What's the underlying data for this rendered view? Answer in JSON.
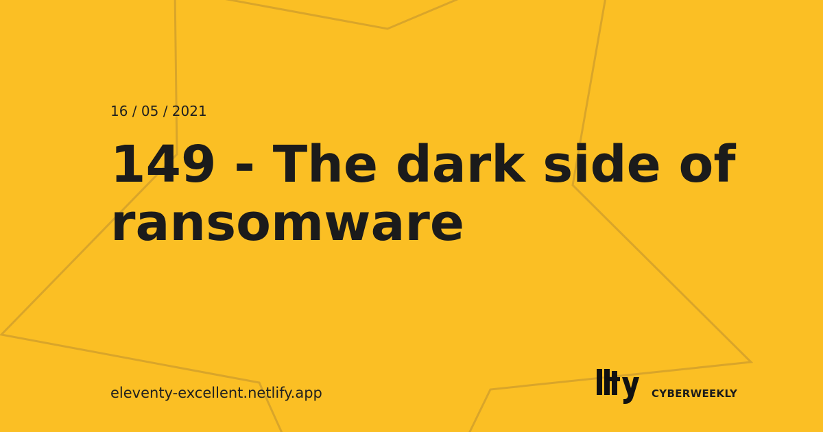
{
  "post": {
    "date": "16 / 05 / 2021",
    "title": "149 - The dark side of ransomware"
  },
  "footer": {
    "site_url": "eleventy-excellent.netlify.app",
    "logo_icon": "11ty-logo-icon",
    "brand_name": "CYBERWEEKLY"
  },
  "colors": {
    "background": "#FBBF24",
    "text": "#1b1b1b",
    "decorative_outline": "#D9A52A"
  }
}
